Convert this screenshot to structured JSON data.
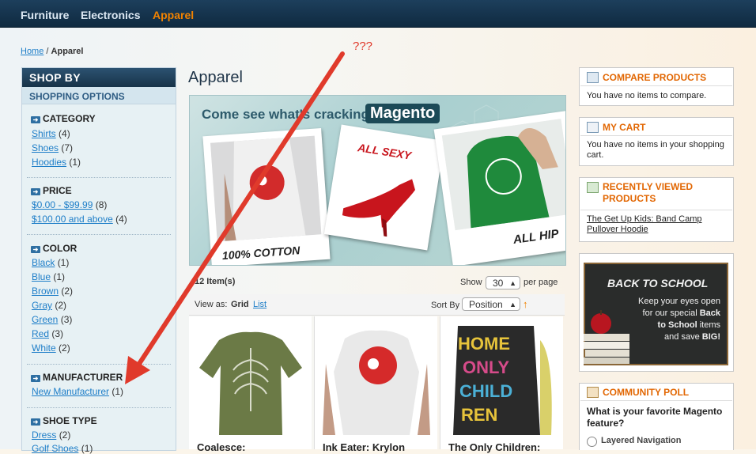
{
  "nav": [
    "Furniture",
    "Electronics",
    "Apparel"
  ],
  "breadcrumb": {
    "home": "Home",
    "separator": "/",
    "current": "Apparel"
  },
  "sidebar": {
    "shop_by": "SHOP BY",
    "shopping_options": "SHOPPING OPTIONS",
    "filters": [
      {
        "name": "CATEGORY",
        "items": [
          {
            "label": "Shirts",
            "count": "(4)"
          },
          {
            "label": "Shoes",
            "count": "(7)"
          },
          {
            "label": "Hoodies",
            "count": "(1)"
          }
        ]
      },
      {
        "name": "PRICE",
        "items": [
          {
            "label": "$0.00 - $99.99",
            "count": "(8)"
          },
          {
            "label": "$100.00 and above",
            "count": "(4)"
          }
        ]
      },
      {
        "name": "COLOR",
        "items": [
          {
            "label": "Black",
            "count": "(1)"
          },
          {
            "label": "Blue",
            "count": "(1)"
          },
          {
            "label": "Brown",
            "count": "(2)"
          },
          {
            "label": "Gray",
            "count": "(2)"
          },
          {
            "label": "Green",
            "count": "(3)"
          },
          {
            "label": "Red",
            "count": "(3)"
          },
          {
            "label": "White",
            "count": "(2)"
          }
        ]
      },
      {
        "name": "MANUFACTURER",
        "items": [
          {
            "label": "New Manufacturer",
            "count": "(1)"
          }
        ]
      },
      {
        "name": "SHOE TYPE",
        "items": [
          {
            "label": "Dress",
            "count": "(2)"
          },
          {
            "label": "Golf Shoes",
            "count": "(1)"
          }
        ]
      }
    ]
  },
  "main": {
    "title": "Apparel",
    "banner": {
      "text": "Come see what's cracking at",
      "brand": "Magento",
      "captions": [
        "100% COTTON",
        "ALL SEXY",
        "ALL HIP"
      ]
    },
    "toolbar": {
      "item_count": "12 Item(s)",
      "show_label": "Show",
      "show_value": "30",
      "per_page": "per page",
      "view_as": "View as:",
      "view_grid": "Grid",
      "view_list": "List",
      "sort_by": "Sort By",
      "sort_value": "Position",
      "sort_dir_icon": "↑"
    },
    "products": [
      {
        "name": "Coalesce:"
      },
      {
        "name": "Ink Eater: Krylon"
      },
      {
        "name": "The Only Children:"
      }
    ]
  },
  "right": {
    "compare": {
      "title": "COMPARE PRODUCTS",
      "text": "You have no items to compare."
    },
    "cart": {
      "title": "MY CART",
      "text": "You have no items in your shopping cart."
    },
    "recent": {
      "title": "RECENTLY VIEWED PRODUCTS",
      "link": "The Get Up Kids: Band Camp Pullover Hoodie"
    },
    "promo": {
      "headline": "BACK TO SCHOOL",
      "line1": "Keep your eyes open",
      "line2a": "for our special",
      "line2b": "Back",
      "line3a": "to School",
      "line3b": "items",
      "line4a": "and save",
      "line4b": "BIG!"
    },
    "poll": {
      "title": "COMMUNITY POLL",
      "question": "What is your favorite Magento feature?",
      "option1": "Layered Navigation"
    }
  },
  "annotation": "???",
  "colors": {
    "accent": "#f18200",
    "link": "#1e7ec8",
    "arrow": "#e03a2b"
  }
}
